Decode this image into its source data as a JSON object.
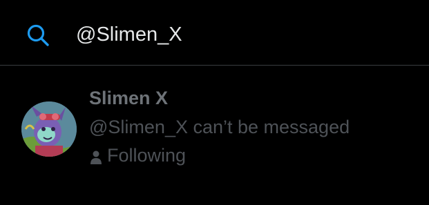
{
  "search": {
    "value": "@Slimen_X",
    "icon": "search-icon",
    "accent_color": "#1d9bf0"
  },
  "result": {
    "display_name": "Slimen X",
    "status_text": "@Slimen_X can’t be messaged",
    "relationship_icon": "person-icon",
    "relationship_label": "Following"
  }
}
